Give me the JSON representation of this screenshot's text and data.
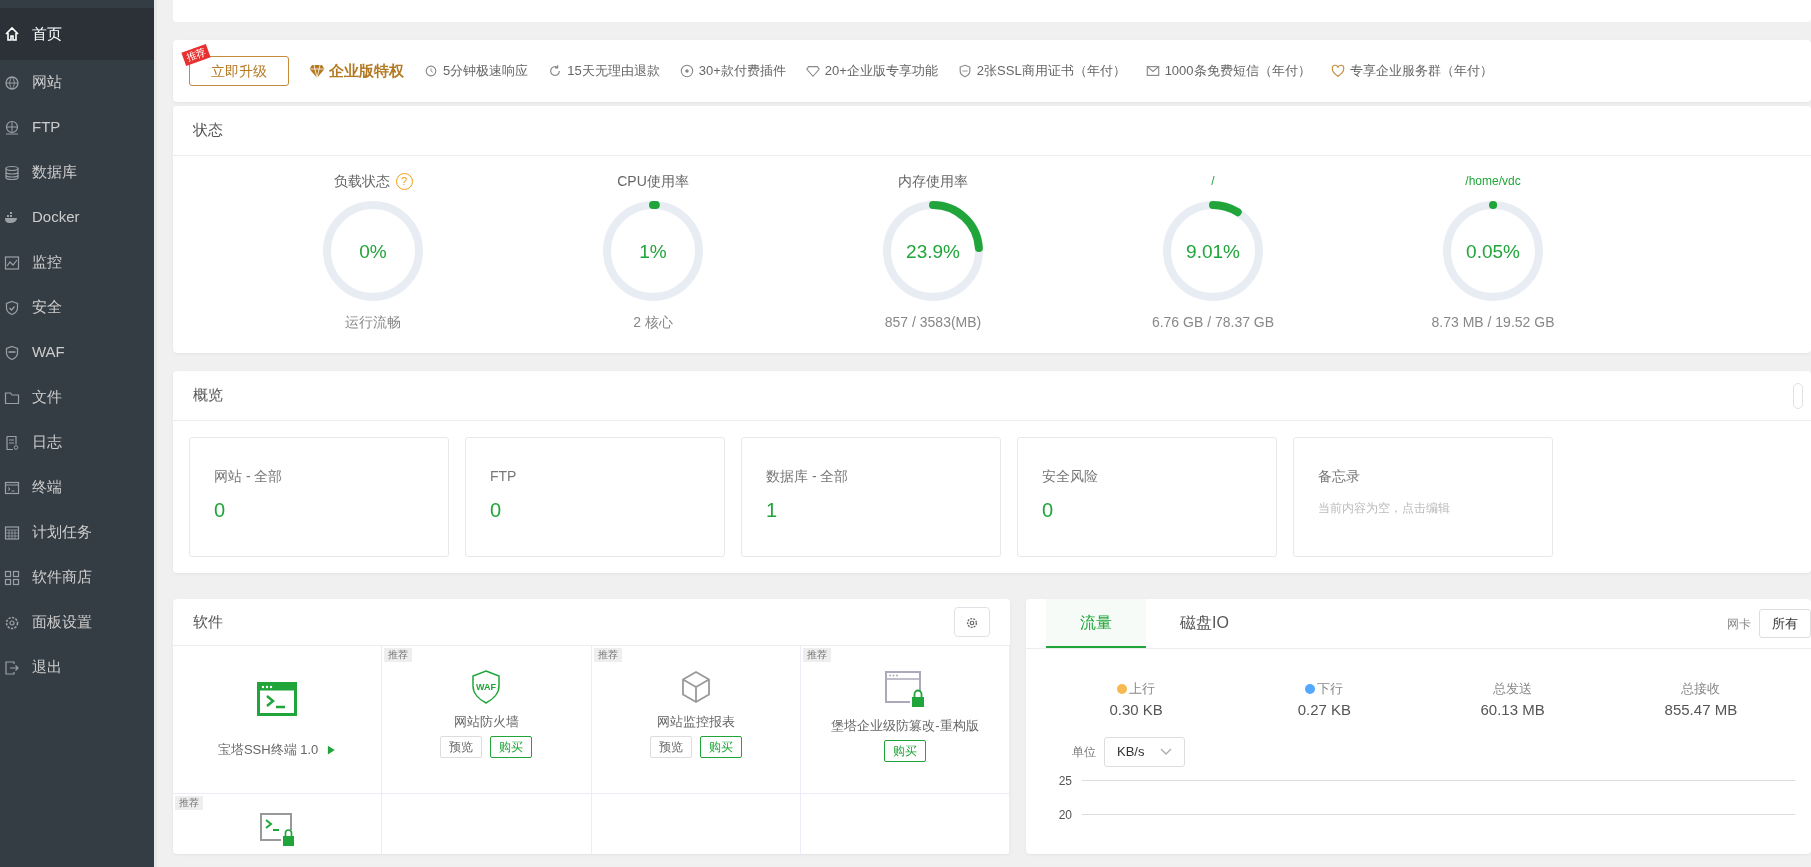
{
  "sidebar": {
    "items": [
      {
        "label": "首页",
        "selected": true
      },
      {
        "label": "网站",
        "selected": false
      },
      {
        "label": "FTP",
        "selected": false
      },
      {
        "label": "数据库",
        "selected": false
      },
      {
        "label": "Docker",
        "selected": false
      },
      {
        "label": "监控",
        "selected": false
      },
      {
        "label": "安全",
        "selected": false
      },
      {
        "label": "WAF",
        "selected": false
      },
      {
        "label": "文件",
        "selected": false
      },
      {
        "label": "日志",
        "selected": false
      },
      {
        "label": "终端",
        "selected": false
      },
      {
        "label": "计划任务",
        "selected": false
      },
      {
        "label": "软件商店",
        "selected": false
      },
      {
        "label": "面板设置",
        "selected": false
      },
      {
        "label": "退出",
        "selected": false
      }
    ]
  },
  "upgrade_bar": {
    "button": "立即升级",
    "ribbon": "推荐",
    "title": "企业版特权",
    "features": [
      "5分钟极速响应",
      "15天无理由退款",
      "30+款付费插件",
      "20+企业版专享功能",
      "2张SSL商用证书（年付）",
      "1000条免费短信（年付）",
      "专享企业服务群（年付）"
    ]
  },
  "status": {
    "title": "状态",
    "gauges": [
      {
        "kind": "metric",
        "label": "负载状态",
        "help_mark": "?",
        "value": "0%",
        "level": 0,
        "caption": "运行流畅"
      },
      {
        "kind": "metric",
        "label": "CPU使用率",
        "value": "1%",
        "level": 0.01,
        "caption": "2 核心"
      },
      {
        "kind": "metric",
        "label": "内存使用率",
        "value": "23.9%",
        "level": 0.239,
        "caption": "857 / 3583(MB)"
      },
      {
        "kind": "disk",
        "label": "/",
        "value": "9.01%",
        "level": 0.0901,
        "caption": "6.76 GB / 78.37 GB"
      },
      {
        "kind": "disk",
        "label": "/home/vdc",
        "value": "0.05%",
        "level": 0.0005,
        "caption": "8.73 MB / 19.52 GB"
      }
    ]
  },
  "overview": {
    "title": "概览",
    "cards": [
      {
        "label": "网站 - 全部",
        "value": "0"
      },
      {
        "label": "FTP",
        "value": "0"
      },
      {
        "label": "数据库 - 全部",
        "value": "1"
      },
      {
        "label": "安全风险",
        "value": "0"
      },
      {
        "label": "备忘录",
        "note": "当前内容为空，点击编辑"
      }
    ]
  },
  "software": {
    "title": "软件",
    "items": [
      {
        "kind": "installed",
        "name": "宝塔SSH终端 1.0"
      },
      {
        "kind": "recommended",
        "tag": "推荐",
        "icon_text": "WAF",
        "name": "网站防火墙",
        "buttons": [
          "预览",
          "购买"
        ]
      },
      {
        "kind": "recommended",
        "tag": "推荐",
        "name": "网站监控报表",
        "buttons": [
          "预览",
          "购买"
        ]
      },
      {
        "kind": "recommended",
        "tag": "推荐",
        "name": "堡塔企业级防篡改-重构版",
        "buttons": [
          "购买"
        ]
      },
      {
        "kind": "recommended",
        "tag": "推荐"
      }
    ]
  },
  "traffic": {
    "tabs": [
      {
        "label": "流量",
        "selected": true
      },
      {
        "label": "磁盘IO",
        "selected": false
      }
    ],
    "nic_label": "网卡",
    "nic_value": "所有",
    "stats": [
      {
        "label": "上行",
        "value": "0.30 KB",
        "color": "#f7b851"
      },
      {
        "label": "下行",
        "value": "0.27 KB",
        "color": "#52a9ff"
      },
      {
        "label": "总发送",
        "value": "60.13 MB"
      },
      {
        "label": "总接收",
        "value": "855.47 MB"
      }
    ],
    "unit_label": "单位",
    "unit_value": "KB/s",
    "y_labels": [
      "25",
      "20"
    ]
  }
}
